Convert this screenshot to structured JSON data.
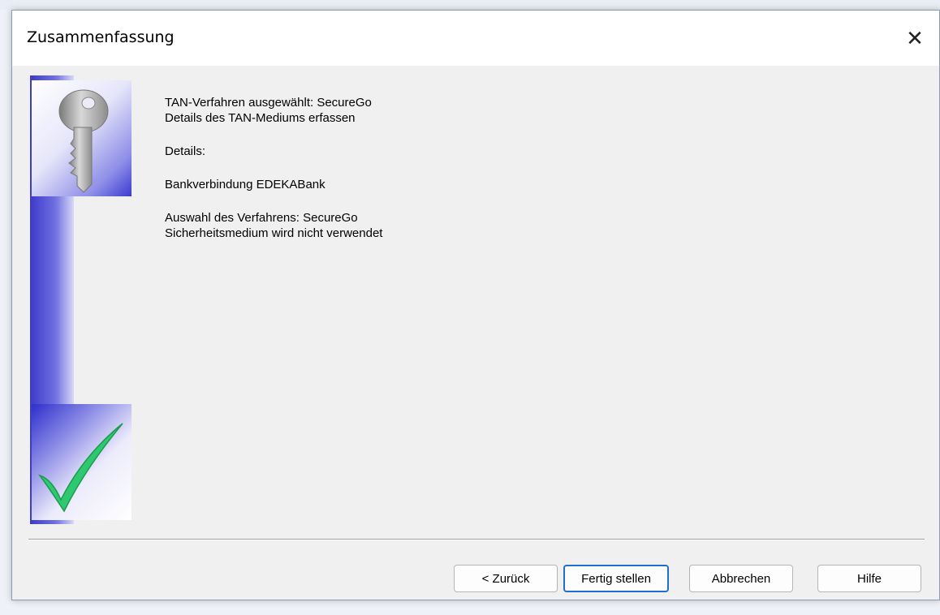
{
  "window": {
    "title": "Zusammenfassung",
    "close_glyph": "✕"
  },
  "summary": {
    "line1": "TAN-Verfahren ausgewählt: SecureGo",
    "line2": "Details des TAN-Mediums erfassen",
    "line3": "Details:",
    "line4": "Bankverbindung EDEKABank",
    "line5": "Auswahl des Verfahrens: SecureGo",
    "line6": "Sicherheitsmedium wird nicht verwendet"
  },
  "buttons": {
    "back": "< Zurück",
    "finish": "Fertig stellen",
    "cancel": "Abbrechen",
    "help": "Hilfe"
  },
  "icons": {
    "key": "key-icon",
    "check": "checkmark-icon"
  },
  "colors": {
    "accent_blue": "#3d3ac8",
    "check_green": "#2ec96f",
    "default_button_border": "#1f6fd0"
  }
}
